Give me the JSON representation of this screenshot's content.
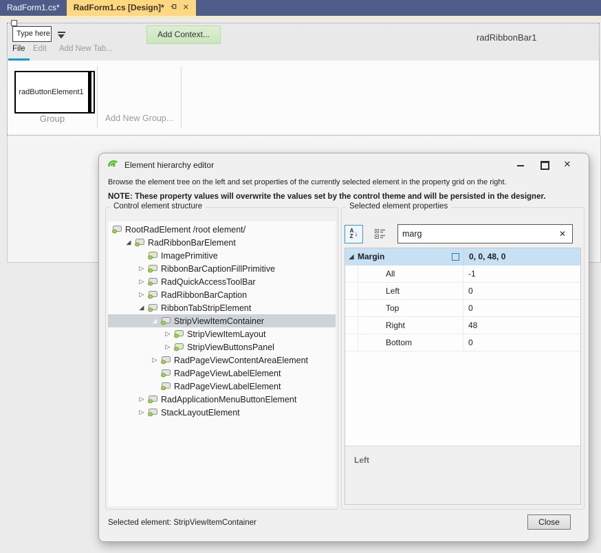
{
  "colors": {
    "canvas": "#EBEBEB",
    "tabbar": "#4D5C89",
    "tabgold": "#FDD880",
    "goldstrip": "#F5EACB",
    "accent": "#1697CE",
    "dlgbg": "#F0F0F0",
    "catblue": "#C7E0F4",
    "selgray": "#CED3DA",
    "green": "#5CC230",
    "ctxgreen": "#DCEFD2"
  },
  "icons": {
    "close": "✕",
    "collapsed": "▷",
    "expanded": "◢",
    "search_clear": "✕",
    "sort_a": "A",
    "sort_z": "Z",
    "sort_arrow": "↓"
  },
  "vs": {
    "tabs": [
      {
        "label": "RadForm1.cs*",
        "active": false
      },
      {
        "label": "RadForm1.cs [Design]*",
        "active": true
      }
    ]
  },
  "ribbon": {
    "type_here": "Type here",
    "add_context": "Add Context...",
    "control_name": "radRibbonBar1",
    "menu": [
      "File",
      "Edit",
      "Add New Tab..."
    ],
    "button_label": "radButtonElement1",
    "group_label": "Group",
    "add_group_label": "Add New Group..."
  },
  "dialog": {
    "title": "Element hierarchy editor",
    "description": "Browse the element tree on the left and set properties of the currently selected element in the property grid on the right.",
    "note": "NOTE: These property values will overwrite the values set by the control theme and will be persisted in the designer.",
    "left_group_label": "Control element structure",
    "right_group_label": "Selected element properties",
    "tree": [
      {
        "label": "RootRadElement /root element/",
        "level": 0,
        "state": "leaf",
        "root": true
      },
      {
        "label": "RadRibbonBarElement",
        "level": 1,
        "state": "expanded"
      },
      {
        "label": "ImagePrimitive",
        "level": 2,
        "state": "leaf",
        "green": true
      },
      {
        "label": "RibbonBarCaptionFillPrimitive",
        "level": 2,
        "state": "collapsed",
        "green": true
      },
      {
        "label": "RadQuickAccessToolBar",
        "level": 2,
        "state": "collapsed"
      },
      {
        "label": "RadRibbonBarCaption",
        "level": 2,
        "state": "collapsed"
      },
      {
        "label": "RibbonTabStripElement",
        "level": 2,
        "state": "expanded"
      },
      {
        "label": "StripViewItemContainer",
        "level": 3,
        "state": "expanded",
        "selected": true
      },
      {
        "label": "StripViewItemLayout",
        "level": 4,
        "state": "collapsed",
        "green": true
      },
      {
        "label": "StripViewButtonsPanel",
        "level": 4,
        "state": "collapsed",
        "green": true
      },
      {
        "label": "RadPageViewContentAreaElement",
        "level": 3,
        "state": "collapsed"
      },
      {
        "label": "RadPageViewLabelElement",
        "level": 3,
        "state": "leaf"
      },
      {
        "label": "RadPageViewLabelElement",
        "level": 3,
        "state": "leaf"
      },
      {
        "label": "RadApplicationMenuButtonElement",
        "level": 2,
        "state": "collapsed"
      },
      {
        "label": "StackLayoutElement",
        "level": 2,
        "state": "collapsed"
      }
    ],
    "search": {
      "value": "marg"
    },
    "grid": {
      "category": {
        "name": "Margin",
        "value": "0, 0, 48, 0"
      },
      "rows": [
        {
          "name": "All",
          "value": "-1"
        },
        {
          "name": "Left",
          "value": "0"
        },
        {
          "name": "Top",
          "value": "0"
        },
        {
          "name": "Right",
          "value": "48"
        },
        {
          "name": "Bottom",
          "value": "0"
        }
      ]
    },
    "description_pane": "Left",
    "footer": {
      "selected_element": "Selected element: StripViewItemContainer",
      "close_label": "Close"
    }
  }
}
